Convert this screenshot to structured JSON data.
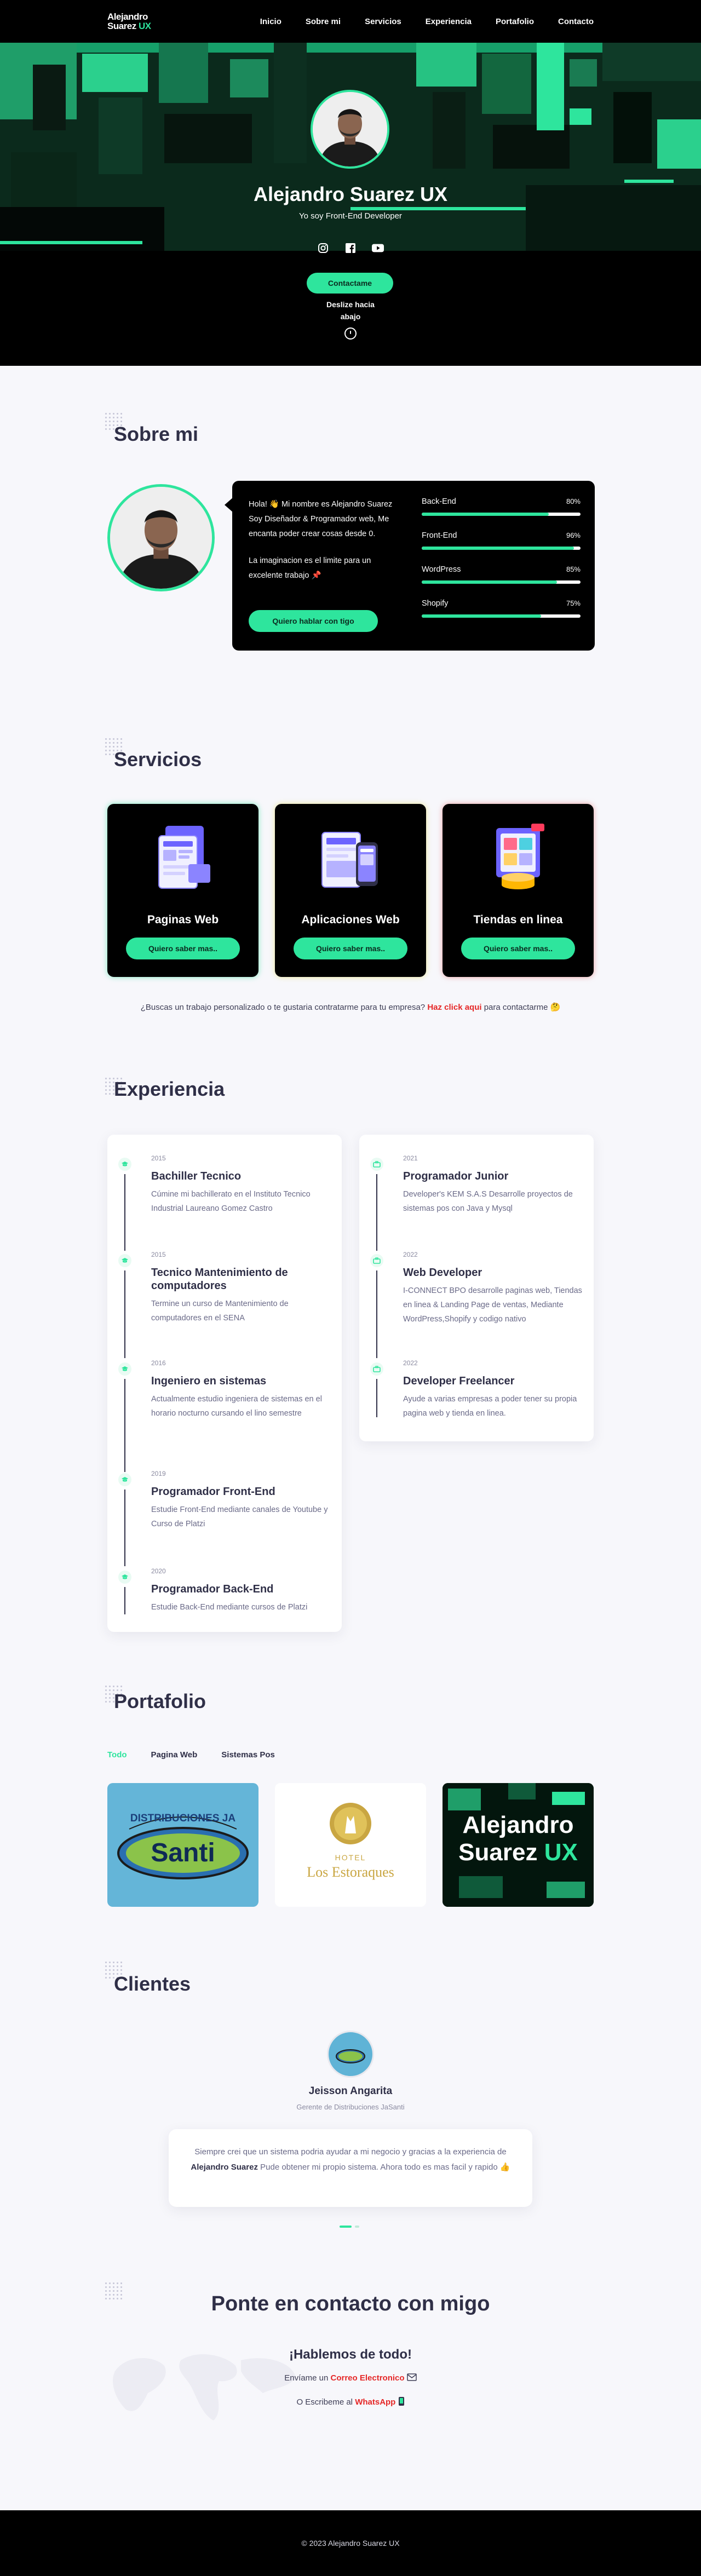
{
  "nav": {
    "logo_line1": "Alejandro",
    "logo_line2a": "Suarez",
    "logo_line2b": "UX",
    "links": [
      "Inicio",
      "Sobre mi",
      "Servicios",
      "Experiencia",
      "Portafolio",
      "Contacto"
    ]
  },
  "hero": {
    "name": "Alejandro Suarez UX",
    "subtitle": "Yo soy Front-End Developer",
    "socials": [
      "instagram-icon",
      "facebook-icon",
      "youtube-icon"
    ],
    "cta": "Contactame",
    "scroll_text": "Deslize hacia abajo"
  },
  "about": {
    "title": "Sobre mi",
    "paragraph1": "Hola! 👋 Mi nombre es Alejandro Suarez Soy Diseñador & Programador web, Me encanta poder crear cosas desde 0.",
    "paragraph2": "La imaginacion es el limite para un excelente trabajo 📌",
    "button": "Quiero hablar con tigo",
    "skills": [
      {
        "name": "Back-End",
        "percent": 80,
        "label": "80%"
      },
      {
        "name": "Front-End",
        "percent": 96,
        "label": "96%"
      },
      {
        "name": "WordPress",
        "percent": 85,
        "label": "85%"
      },
      {
        "name": "Shopify",
        "percent": 75,
        "label": "75%"
      }
    ]
  },
  "services": {
    "title": "Servicios",
    "items": [
      {
        "title": "Paginas Web",
        "button": "Quiero saber mas..",
        "glow": "#2ee59d"
      },
      {
        "title": "Aplicaciones Web",
        "button": "Quiero saber mas..",
        "glow": "#e8e05a"
      },
      {
        "title": "Tiendas en linea",
        "button": "Quiero saber mas..",
        "glow": "#e86a6a"
      }
    ],
    "cta_before": "¿Buscas un trabajo personalizado o te gustaria contratarme para tu empresa?",
    "cta_link": "Haz click aqui",
    "cta_after": "para contactarme 🤔"
  },
  "experience": {
    "title": "Experiencia",
    "left": [
      {
        "year": "2015",
        "title": "Bachiller Tecnico",
        "desc": "Cúmine mi bachillerato en el Instituto Tecnico Industrial Laureano Gomez Castro"
      },
      {
        "year": "2015",
        "title": "Tecnico Mantenimiento de computadores",
        "desc": "Termine un curso de Mantenimiento de computadores en el SENA"
      },
      {
        "year": "2016",
        "title": "Ingeniero en sistemas",
        "desc": "Actualmente estudio ingeniera de sistemas en el horario nocturno cursando el lino semestre"
      },
      {
        "year": "2019",
        "title": "Programador Front-End",
        "desc": "Estudie Front-End mediante canales de Youtube y Curso de Platzi"
      },
      {
        "year": "2020",
        "title": "Programador Back-End",
        "desc": "Estudie Back-End mediante cursos de Platzi"
      }
    ],
    "right": [
      {
        "year": "2021",
        "title": "Programador Junior",
        "desc": "Developer's KEM S.A.S Desarrolle proyectos de sistemas pos con Java y Mysql"
      },
      {
        "year": "2022",
        "title": "Web Developer",
        "desc": "I-CONNECT BPO desarrolle paginas web, Tiendas en linea & Landing Page de ventas, Mediante WordPress,Shopify y codigo nativo"
      },
      {
        "year": "2022",
        "title": "Developer Freelancer",
        "desc": "Ayude a varias empresas a poder tener su propia pagina web y tienda en linea."
      }
    ]
  },
  "portfolio": {
    "title": "Portafolio",
    "filters": [
      "Todo",
      "Pagina Web",
      "Sistemas Pos"
    ],
    "items": [
      {
        "line1": "DISTRIBUCIONES JA",
        "line2": "Santi"
      },
      {
        "line1": "HOTEL",
        "line2": "Los Estoraques"
      },
      {
        "line1": "Alejandro",
        "line2a": "Suarez",
        "line2b": "UX"
      }
    ]
  },
  "clients": {
    "title": "Clientes",
    "name": "Jeisson Angarita",
    "role": "Gerente de Distribuciones JaSanti",
    "quote_before": "Siempre crei que un sistema podria ayudar a mi negocio y gracias a la experiencia de",
    "quote_bold": "Alejandro Suarez",
    "quote_after": "Pude obtener mi propio sistema. Ahora todo es mas facil y rapido 👍"
  },
  "contact": {
    "title": "Ponte en contacto con migo",
    "subtitle": "¡Hablemos de todo!",
    "email_prefix": "Envíame un",
    "email_link": "Correo Electronico",
    "wa_prefix": "O Escribeme al",
    "wa_link": "WhatsApp"
  },
  "footer": {
    "copyright": "© 2023 Alejandro Suarez UX"
  },
  "colors": {
    "accent": "#2ee59d",
    "dark": "#000000",
    "link_red": "#e52727",
    "page_bg": "#f7f7fb"
  }
}
